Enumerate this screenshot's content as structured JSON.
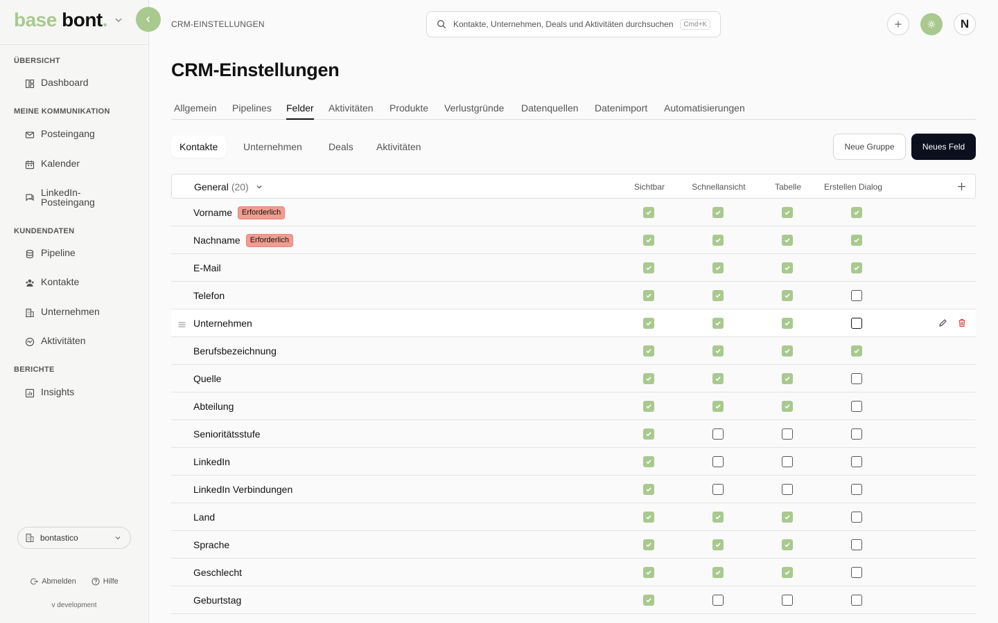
{
  "brand": {
    "part1": "base ",
    "part2": "bont",
    "dot": "."
  },
  "sidebar": {
    "sections": [
      {
        "title": "ÜBERSICHT",
        "items": [
          {
            "label": "Dashboard",
            "icon": "dashboard-icon"
          }
        ]
      },
      {
        "title": "MEINE KOMMUNIKATION",
        "items": [
          {
            "label": "Posteingang",
            "icon": "mail-icon"
          },
          {
            "label": "Kalender",
            "icon": "calendar-icon"
          },
          {
            "label": "LinkedIn-Posteingang",
            "label_line1": "LinkedIn-",
            "label_line2": "Posteingang",
            "icon": "chat-icon"
          }
        ]
      },
      {
        "title": "KUNDENDATEN",
        "items": [
          {
            "label": "Pipeline",
            "icon": "database-icon"
          },
          {
            "label": "Kontakte",
            "icon": "users-icon"
          },
          {
            "label": "Unternehmen",
            "icon": "building-icon"
          },
          {
            "label": "Aktivitäten",
            "icon": "activity-icon"
          }
        ]
      },
      {
        "title": "BERICHTE",
        "items": [
          {
            "label": "Insights",
            "icon": "chart-icon"
          }
        ]
      }
    ],
    "workspace": "bontastico",
    "logout": "Abmelden",
    "help": "Hilfe",
    "version": "v development"
  },
  "header": {
    "breadcrumb": "CRM-EINSTELLUNGEN",
    "search_placeholder": "Kontakte, Unternehmen, Deals und Aktivitäten durchsuchen",
    "search_shortcut": "Cmd+K",
    "avatar_initial": "N"
  },
  "page": {
    "title": "CRM-Einstellungen",
    "tabs": [
      "Allgemein",
      "Pipelines",
      "Felder",
      "Aktivitäten",
      "Produkte",
      "Verlustgründe",
      "Datenquellen",
      "Datenimport",
      "Automatisierungen"
    ],
    "active_tab": "Felder",
    "subtabs": [
      "Kontakte",
      "Unternehmen",
      "Deals",
      "Aktivitäten"
    ],
    "active_subtab": "Kontakte",
    "new_group_label": "Neue Gruppe",
    "new_field_label": "Neues Feld"
  },
  "table": {
    "group_name": "General",
    "group_count": "(20)",
    "columns": [
      "Sichtbar",
      "Schnellansicht",
      "Tabelle",
      "Erstellen Dialog"
    ],
    "required_label": "Erforderlich",
    "colors": {
      "checked": "#a9c98f",
      "badge": "#f19c8f",
      "delete": "#d9342b"
    },
    "rows": [
      {
        "name": "Vorname",
        "required": true,
        "checks": [
          true,
          true,
          true,
          true
        ]
      },
      {
        "name": "Nachname",
        "required": true,
        "checks": [
          true,
          true,
          true,
          true
        ]
      },
      {
        "name": "E-Mail",
        "required": false,
        "checks": [
          true,
          true,
          true,
          true
        ]
      },
      {
        "name": "Telefon",
        "required": false,
        "checks": [
          true,
          true,
          true,
          false
        ]
      },
      {
        "name": "Unternehmen",
        "required": false,
        "checks": [
          true,
          true,
          true,
          false
        ],
        "hover": true
      },
      {
        "name": "Berufsbezeichnung",
        "required": false,
        "checks": [
          true,
          true,
          true,
          true
        ]
      },
      {
        "name": "Quelle",
        "required": false,
        "checks": [
          true,
          true,
          true,
          false
        ]
      },
      {
        "name": "Abteilung",
        "required": false,
        "checks": [
          true,
          true,
          true,
          false
        ]
      },
      {
        "name": "Senioritätsstufe",
        "required": false,
        "checks": [
          true,
          false,
          false,
          false
        ]
      },
      {
        "name": "LinkedIn",
        "required": false,
        "checks": [
          true,
          false,
          false,
          false
        ]
      },
      {
        "name": "LinkedIn Verbindungen",
        "required": false,
        "checks": [
          true,
          false,
          false,
          false
        ]
      },
      {
        "name": "Land",
        "required": false,
        "checks": [
          true,
          true,
          true,
          false
        ]
      },
      {
        "name": "Sprache",
        "required": false,
        "checks": [
          true,
          true,
          true,
          false
        ]
      },
      {
        "name": "Geschlecht",
        "required": false,
        "checks": [
          true,
          true,
          true,
          false
        ]
      },
      {
        "name": "Geburtstag",
        "required": false,
        "checks": [
          true,
          false,
          false,
          false
        ]
      }
    ]
  }
}
